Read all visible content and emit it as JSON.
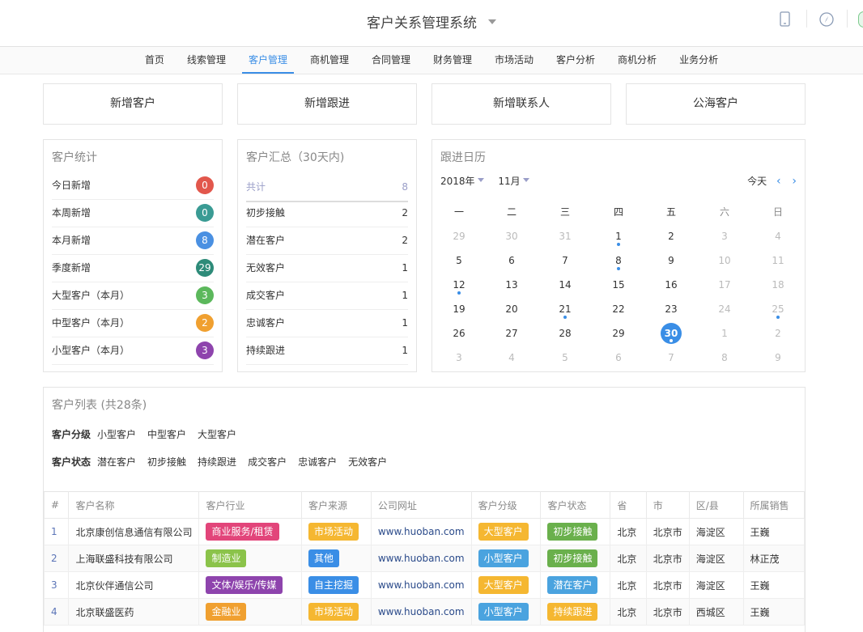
{
  "app": {
    "title": "客户关系管理系统"
  },
  "nav": [
    "首页",
    "线索管理",
    "客户管理",
    "商机管理",
    "合同管理",
    "财务管理",
    "市场活动",
    "客户分析",
    "商机分析",
    "业务分析"
  ],
  "quick_actions": [
    "新增客户",
    "新增跟进",
    "新增联系人",
    "公海客户"
  ],
  "stats": {
    "title": "客户统计",
    "rows": [
      {
        "label": "今日新增",
        "value": "0",
        "color": "#e2574c"
      },
      {
        "label": "本周新增",
        "value": "0",
        "color": "#3a9b94"
      },
      {
        "label": "本月新增",
        "value": "8",
        "color": "#4a90e2"
      },
      {
        "label": "季度新增",
        "value": "29",
        "color": "#2e8b79"
      },
      {
        "label": "大型客户（本月）",
        "value": "3",
        "color": "#5cb85c"
      },
      {
        "label": "中型客户（本月）",
        "value": "2",
        "color": "#f0a030"
      },
      {
        "label": "小型客户（本月）",
        "value": "3",
        "color": "#8e44ad"
      }
    ]
  },
  "summary": {
    "title": "客户汇总（30天内)",
    "total_label": "共计",
    "total_value": "8",
    "rows": [
      {
        "label": "初步接触",
        "value": "2"
      },
      {
        "label": "潜在客户",
        "value": "2"
      },
      {
        "label": "无效客户",
        "value": "1"
      },
      {
        "label": "成交客户",
        "value": "1"
      },
      {
        "label": "忠诚客户",
        "value": "1"
      },
      {
        "label": "持续跟进",
        "value": "1"
      }
    ]
  },
  "calendar": {
    "title": "跟进日历",
    "year": "2018年",
    "month": "11月",
    "today_label": "今天",
    "weekdays": [
      "一",
      "二",
      "三",
      "四",
      "五",
      "六",
      "日"
    ],
    "weeks": [
      [
        {
          "d": "29",
          "m": true
        },
        {
          "d": "30",
          "m": true
        },
        {
          "d": "31",
          "m": true
        },
        {
          "d": "1",
          "dot": true
        },
        {
          "d": "2"
        },
        {
          "d": "3",
          "m": true
        },
        {
          "d": "4",
          "m": true
        }
      ],
      [
        {
          "d": "5"
        },
        {
          "d": "6"
        },
        {
          "d": "7"
        },
        {
          "d": "8",
          "dot": true
        },
        {
          "d": "9"
        },
        {
          "d": "10",
          "m": true
        },
        {
          "d": "11",
          "m": true
        }
      ],
      [
        {
          "d": "12",
          "dot": true
        },
        {
          "d": "13"
        },
        {
          "d": "14"
        },
        {
          "d": "15"
        },
        {
          "d": "16"
        },
        {
          "d": "17",
          "m": true
        },
        {
          "d": "18",
          "m": true
        }
      ],
      [
        {
          "d": "19"
        },
        {
          "d": "20"
        },
        {
          "d": "21",
          "dot": true
        },
        {
          "d": "22"
        },
        {
          "d": "23"
        },
        {
          "d": "24",
          "m": true
        },
        {
          "d": "25",
          "m": true,
          "dot": true
        }
      ],
      [
        {
          "d": "26"
        },
        {
          "d": "27"
        },
        {
          "d": "28"
        },
        {
          "d": "29"
        },
        {
          "d": "30",
          "today": true,
          "dot": true
        },
        {
          "d": "1",
          "m": true
        },
        {
          "d": "2",
          "m": true
        }
      ],
      [
        {
          "d": "3",
          "m": true
        },
        {
          "d": "4",
          "m": true
        },
        {
          "d": "5",
          "m": true
        },
        {
          "d": "6",
          "m": true
        },
        {
          "d": "7",
          "m": true
        },
        {
          "d": "8",
          "m": true
        },
        {
          "d": "9",
          "m": true
        }
      ]
    ]
  },
  "customer_list": {
    "title": "客户列表 (共28条)",
    "filters": [
      {
        "label": "客户分级",
        "options": [
          "小型客户",
          "中型客户",
          "大型客户"
        ]
      },
      {
        "label": "客户状态",
        "options": [
          "潜在客户",
          "初步接触",
          "持续跟进",
          "成交客户",
          "忠诚客户",
          "无效客户"
        ]
      }
    ],
    "columns": [
      "#",
      "客户名称",
      "客户行业",
      "客户来源",
      "公司网址",
      "客户分级",
      "客户状态",
      "省",
      "市",
      "区/县",
      "所属销售"
    ],
    "rows": [
      {
        "idx": "1",
        "name": "北京康创信息通信有限公司",
        "industry": {
          "t": "商业服务/租赁",
          "c": "#e2457a"
        },
        "source": {
          "t": "市场活动",
          "c": "#f5b731"
        },
        "url": "www.huoban.com",
        "level": {
          "t": "大型客户",
          "c": "#f5b731"
        },
        "status": {
          "t": "初步接触",
          "c": "#6ab04c"
        },
        "prov": "北京",
        "city": "北京市",
        "district": "海淀区",
        "sales": "王巍"
      },
      {
        "idx": "2",
        "name": "上海联盛科技有限公司",
        "industry": {
          "t": "制造业",
          "c": "#8bc34a"
        },
        "source": {
          "t": "其他",
          "c": "#3a8ee6"
        },
        "url": "www.huoban.com",
        "level": {
          "t": "小型客户",
          "c": "#4aa3df"
        },
        "status": {
          "t": "初步接触",
          "c": "#6ab04c"
        },
        "prov": "北京",
        "city": "北京市",
        "district": "海淀区",
        "sales": "林正茂"
      },
      {
        "idx": "3",
        "name": "北京伙伴通信公司",
        "industry": {
          "t": "文体/娱乐/传媒",
          "c": "#8e44ad"
        },
        "source": {
          "t": "自主挖掘",
          "c": "#3a8ee6"
        },
        "url": "www.huoban.com",
        "level": {
          "t": "大型客户",
          "c": "#f5b731"
        },
        "status": {
          "t": "潜在客户",
          "c": "#4aa3df"
        },
        "prov": "北京",
        "city": "北京市",
        "district": "海淀区",
        "sales": "王巍"
      },
      {
        "idx": "4",
        "name": "北京联盛医药",
        "industry": {
          "t": "金融业",
          "c": "#f0a030"
        },
        "source": {
          "t": "市场活动",
          "c": "#f5b731"
        },
        "url": "www.huoban.com",
        "level": {
          "t": "小型客户",
          "c": "#4aa3df"
        },
        "status": {
          "t": "持续跟进",
          "c": "#f5b731"
        },
        "prov": "北京",
        "city": "北京市",
        "district": "西城区",
        "sales": "王巍"
      }
    ]
  }
}
